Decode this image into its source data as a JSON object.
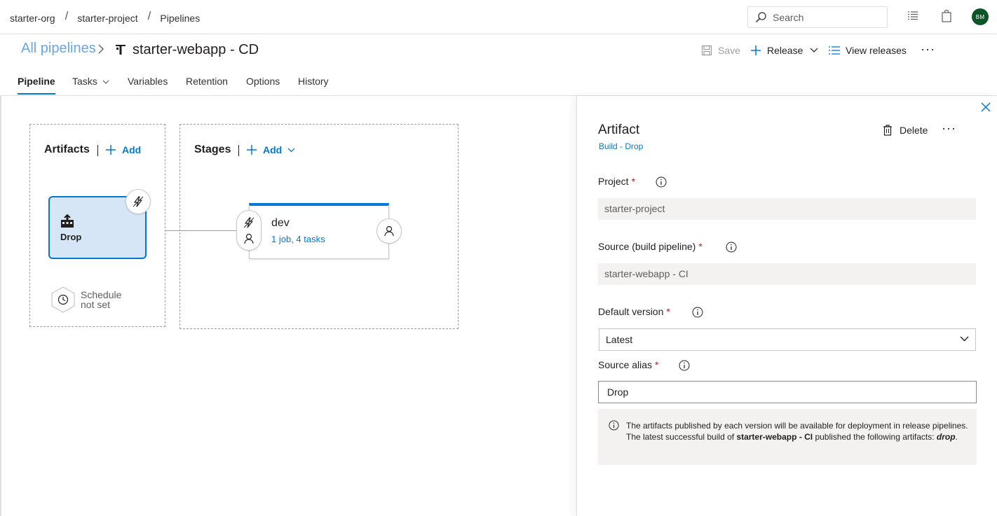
{
  "breadcrumb": {
    "org": "starter-org",
    "project": "starter-project",
    "section": "Pipelines",
    "separator": "/"
  },
  "search": {
    "placeholder": "Search"
  },
  "user": {
    "initials": "BM"
  },
  "header": {
    "all_pipelines": "All pipelines",
    "title": "starter-webapp - CD",
    "save_label": "Save",
    "release_label": "Release",
    "view_releases_label": "View releases",
    "more": "···"
  },
  "tabs": [
    {
      "label": "Pipeline",
      "active": true
    },
    {
      "label": "Tasks"
    },
    {
      "label": "Variables"
    },
    {
      "label": "Retention"
    },
    {
      "label": "Options"
    },
    {
      "label": "History"
    }
  ],
  "canvas": {
    "artifacts_title": "Artifacts",
    "artifacts_add": "Add",
    "stages_title": "Stages",
    "stages_add": "Add",
    "artifact": {
      "name": "Drop"
    },
    "schedule": {
      "line1": "Schedule",
      "line2": "not set"
    },
    "stage": {
      "name": "dev",
      "summary": "1 job, 4 tasks"
    }
  },
  "panel": {
    "title": "Artifact",
    "subtitle": "Build - Drop",
    "delete_label": "Delete",
    "more": "···",
    "project_label": "Project",
    "project_value": "starter-project",
    "source_label": "Source (build pipeline)",
    "source_value": "starter-webapp - CI",
    "default_version_label": "Default version",
    "default_version_value": "Latest",
    "alias_label": "Source alias",
    "alias_value": "Drop",
    "required_mark": "*",
    "info_text_1": "The artifacts published by each version will be available for deployment in release pipelines. The latest successful build of ",
    "info_bold": "starter-webapp - CI",
    "info_text_2": "  published the following artifacts: ",
    "info_artifact": "drop",
    "info_end": "."
  },
  "colors": {
    "accent": "#0078d4",
    "artifact_bg": "#d6e6f6",
    "required": "#a4262c",
    "avatar": "#0b5526"
  }
}
